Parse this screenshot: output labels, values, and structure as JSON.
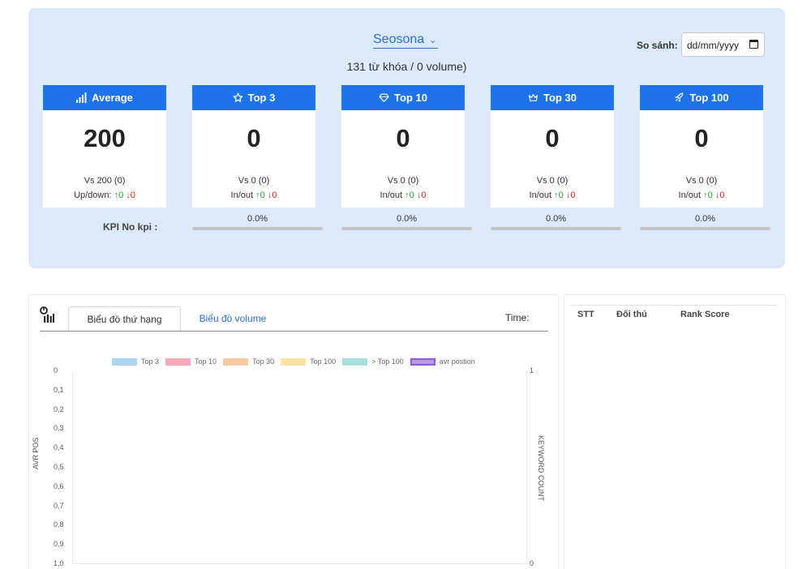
{
  "summary": {
    "project_name": "Seosona",
    "keywords_text": "131 từ khóa / 0 volume)",
    "compare_label": "So sánh:",
    "date_placeholder": "dd/mm/yyyy",
    "kpi_label": "KPI No kpi :",
    "cards": [
      {
        "title": "Average",
        "icon": "bar-signal-icon",
        "value": "200",
        "vs": "Vs 200 (0)",
        "change_label": "Up/down:",
        "up": "0",
        "down": "0"
      },
      {
        "title": "Top 3",
        "icon": "star-icon",
        "value": "0",
        "vs": "Vs 0 (0)",
        "change_label": "In/out",
        "up": "0",
        "down": "0"
      },
      {
        "title": "Top 10",
        "icon": "diamond-icon",
        "value": "0",
        "vs": "Vs 0 (0)",
        "change_label": "In/out",
        "up": "0",
        "down": "0"
      },
      {
        "title": "Top 30",
        "icon": "crown-icon",
        "value": "0",
        "vs": "Vs 0 (0)",
        "change_label": "In/out",
        "up": "0",
        "down": "0"
      },
      {
        "title": "Top 100",
        "icon": "rocket-icon",
        "value": "0",
        "vs": "Vs 0 (0)",
        "change_label": "In/out",
        "up": "0",
        "down": "0"
      }
    ],
    "kpi_progress": [
      {
        "percent_text": "0.0%",
        "fill_fraction": 0
      },
      {
        "percent_text": "0.0%",
        "fill_fraction": 0
      },
      {
        "percent_text": "0.0%",
        "fill_fraction": 0
      },
      {
        "percent_text": "0.0%",
        "fill_fraction": 0
      }
    ],
    "colors": {
      "panel_bg": "#dce9fb",
      "card_header": "#1f73ea",
      "up": "#1f9d3a",
      "down": "#d9241c"
    }
  },
  "chart_panel": {
    "tabs": [
      {
        "label": "Biểu đồ thứ hạng",
        "active": true
      },
      {
        "label": "Biểu đồ volume",
        "active": false
      }
    ],
    "time_label": "Time:"
  },
  "chart_data": {
    "type": "bar",
    "legend": [
      {
        "name": "Top 3",
        "color": "#a8d3f2"
      },
      {
        "name": "Top 10",
        "color": "#f6aab8"
      },
      {
        "name": "Top 30",
        "color": "#f8cca0"
      },
      {
        "name": "Top 100",
        "color": "#fbe4a4"
      },
      {
        "name": "> Top 100",
        "color": "#a6dfdc"
      },
      {
        "name": "avr postion",
        "color": "#b898ec"
      }
    ],
    "ylabel_left": "AVR POS",
    "ylabel_right": "KEYWORD COUNT",
    "left_ticks": [
      "0",
      "0,1",
      "0,2",
      "0,3",
      "0,4",
      "0,5",
      "0,6",
      "0,7",
      "0,8",
      "0,9",
      "1,0"
    ],
    "right_ticks": [
      "1",
      "0"
    ],
    "ylim_left": [
      0,
      1
    ],
    "ylim_right": [
      0,
      1
    ],
    "left_axis_reversed": true,
    "series": []
  },
  "rank_panel": {
    "columns": [
      "STT",
      "Đối thủ",
      "Rank Score"
    ]
  }
}
